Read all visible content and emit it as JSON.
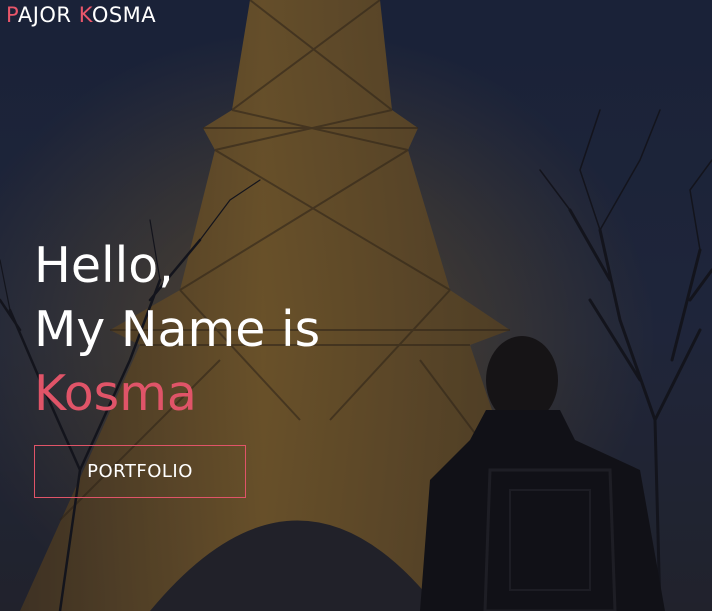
{
  "header": {
    "brand": {
      "first_initial": "P",
      "first_rest": "AJOR ",
      "last_initial": "K",
      "last_rest": "OSMA"
    }
  },
  "hero": {
    "greeting_line1": "Hello,",
    "greeting_line2": "My Name is",
    "name": "Kosma",
    "cta_label": "PORTFOLIO"
  },
  "colors": {
    "accent": "#e05468",
    "text": "#ffffff",
    "sky": "#1d2a45"
  }
}
